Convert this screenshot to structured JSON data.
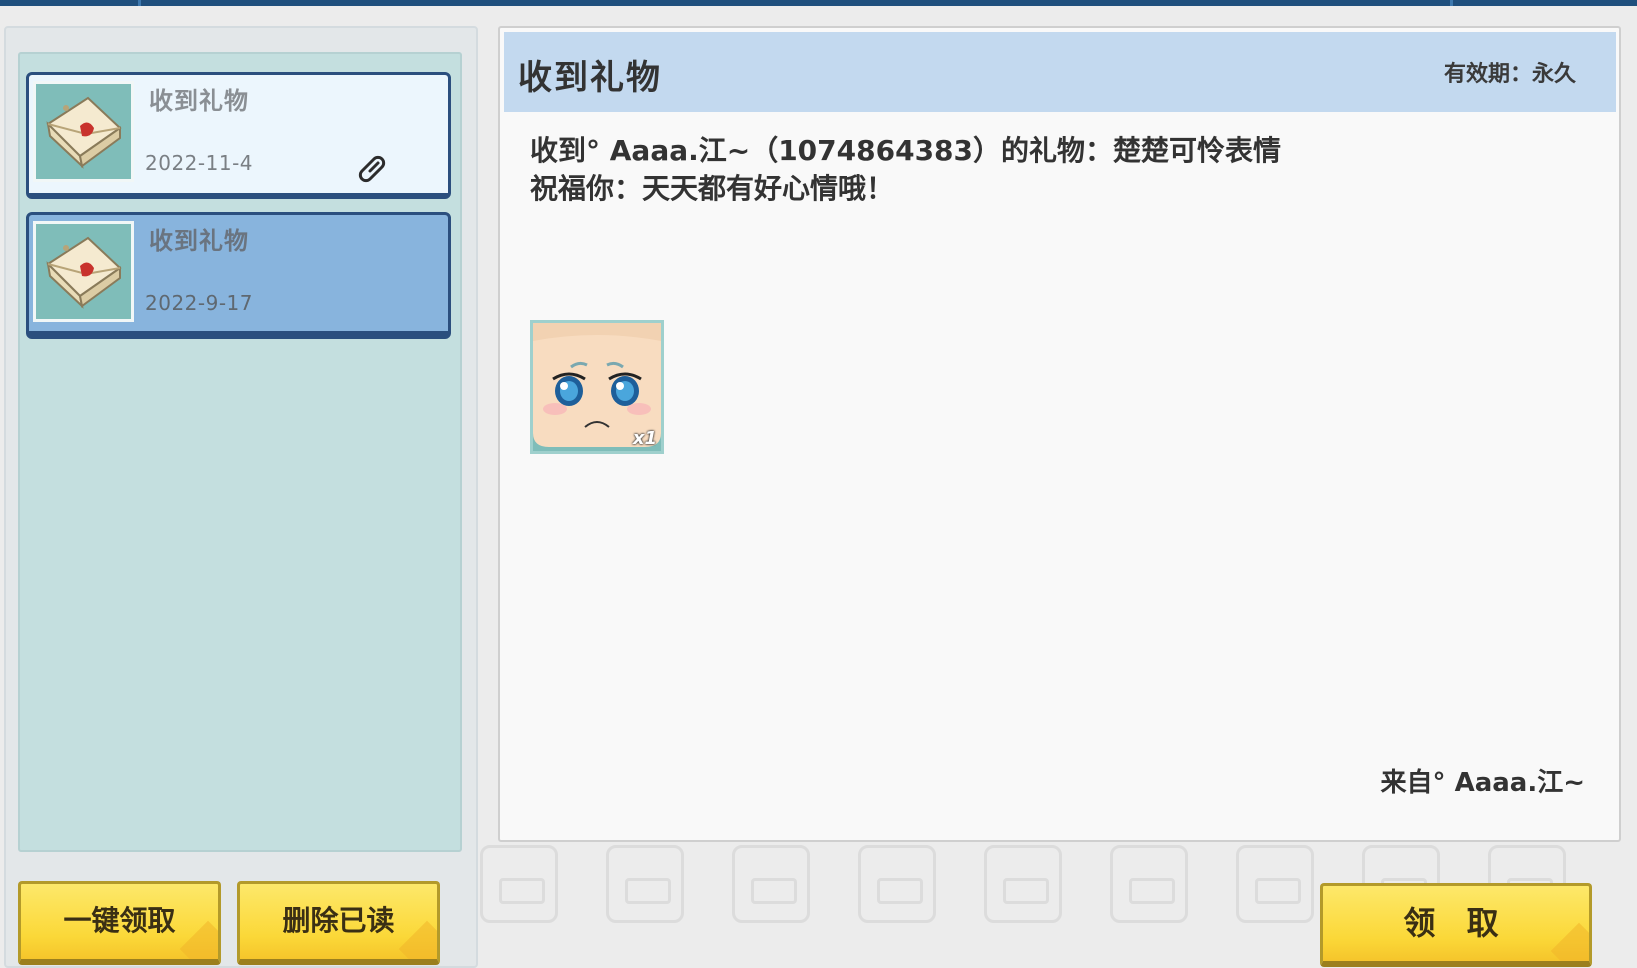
{
  "mail_list": {
    "items": [
      {
        "title": "收到礼物",
        "date": "2022-11-4",
        "state": "unread",
        "has_attachment": true,
        "icon": "envelope-icon"
      },
      {
        "title": "收到礼物",
        "date": "2022-9-17",
        "state": "selected",
        "has_attachment": false,
        "icon": "envelope-icon"
      }
    ]
  },
  "buttons": {
    "claim_all": "一键领取",
    "delete_read": "删除已读",
    "claim": "领 取"
  },
  "detail": {
    "title": "收到礼物",
    "validity": "有效期：永久",
    "line1": "收到° Aaaa.江~（1074864383）的礼物：楚楚可怜表情",
    "line2": "祝福你：天天都有好心情哦！",
    "gift": {
      "name": "楚楚可怜表情",
      "count": "x1",
      "icon": "pitiful-face-icon"
    },
    "sender": "来自° Aaaa.江~"
  },
  "colors": {
    "selected_item": "#88b4dd",
    "unread_item": "#ecf6fd",
    "header_bg": "#c3d9ef",
    "button_yellow": "#fbd838",
    "list_bg": "#c4dfdf"
  }
}
